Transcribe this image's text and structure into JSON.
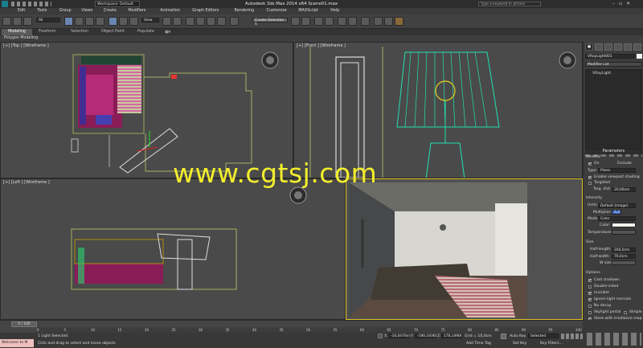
{
  "titlebar": {
    "title": "Autodesk 3ds Max  2014 x64     Scene01.max",
    "search_placeholder": "Type a keyword or phrase",
    "workspace": "Workspace: Default"
  },
  "menu": [
    "Edit",
    "Tools",
    "Group",
    "Views",
    "Create",
    "Modifiers",
    "Animation",
    "Graph Editors",
    "Rendering",
    "Customize",
    "MAXScript",
    "Help"
  ],
  "toolbar": {
    "selection_filter": "All",
    "view_dropdown": "View",
    "named_selection": "Create Selection S"
  },
  "ribbon": {
    "tabs": [
      "Modeling",
      "Freeform",
      "Selection",
      "Object Paint",
      "Populate"
    ],
    "subtab": "Polygon Modeling"
  },
  "viewports": {
    "top": "[+] [Top ] [Wireframe ]",
    "front": "[+] [Front ] [Wireframe ]",
    "left": "[+] [Left ] [Wireframe ]"
  },
  "watermark": "www.cgtsj.com",
  "command_panel": {
    "object_name": "VRayLight001",
    "modifier_list": "Modifier List",
    "stack_item": "VRayLight",
    "rollout_parameters": "Parameters",
    "general": "General",
    "on_label": "On",
    "exclude_label": "Exclude",
    "type_label": "Type:",
    "type_value": "Plane",
    "enable_viewport_shading": "Enable viewport shading",
    "targeted": "Targeted",
    "targ_dist_label": "Targ. dist:",
    "targ_dist_value": "20,00cm",
    "intensity": "Intensity",
    "units_label": "Units:",
    "units_value": "Default (image)",
    "multiplier_label": "Multiplier:",
    "multiplier_value": "6,0",
    "mode_label": "Mode:",
    "mode_value": "Color",
    "color_label": "Color:",
    "temperature_label": "Temperature:",
    "size": "Size",
    "half_length_label": "Half-length:",
    "half_length_value": "200,0cm",
    "half_width_label": "Half-width:",
    "half_width_value": "70,0cm",
    "w_size_label": "W size",
    "options": "Options",
    "cast_shadows": "Cast shadows",
    "double_sided": "Double-sided",
    "invisible": "Invisible",
    "ignore_light_normals": "Ignore light normals",
    "no_decay": "No decay",
    "skylight_portal": "Skylight portal",
    "simple": "Simple",
    "store_irradiance": "Store with irradiance map",
    "affect_diffuse": "Affect diffuse"
  },
  "timeline": {
    "frame": "0 / 100",
    "ticks": [
      "0",
      "5",
      "10",
      "15",
      "20",
      "25",
      "30",
      "35",
      "40",
      "45",
      "50",
      "55",
      "60",
      "65",
      "70",
      "75",
      "80",
      "85",
      "90",
      "95",
      "100"
    ]
  },
  "status": {
    "maxscript_listener": "Welcome to M",
    "selection_info": "1 Light Selected",
    "prompt": "Click and drag to select and move objects",
    "x_label": "X:",
    "x_value": "-10,0476m",
    "y_label": "Y:",
    "y_value": "-190,1936I",
    "z_label": "Z:",
    "z_value": "176,1490I",
    "grid": "Grid = 10,0cm",
    "add_time_tag": "Add Time Tag",
    "auto_key": "Auto Key",
    "set_key": "Set Key",
    "key_filter_dropdown": "Selected",
    "key_filters": "Key Filters..."
  }
}
